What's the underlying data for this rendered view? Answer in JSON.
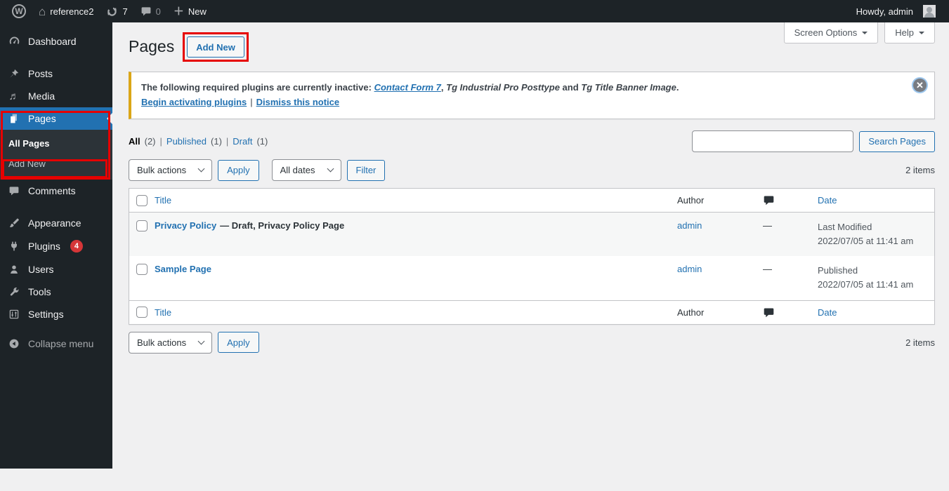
{
  "admin_bar": {
    "site_name": "reference2",
    "update_count": "7",
    "comment_count": "0",
    "new_label": "New",
    "howdy": "Howdy, admin"
  },
  "icons": {
    "wordpress_logo": "W",
    "home": "⌂",
    "plus": "＋",
    "media_note": "♬",
    "dismiss": "✕"
  },
  "sidebar": {
    "items": [
      {
        "label": "Dashboard"
      },
      {
        "label": "Posts"
      },
      {
        "label": "Media"
      },
      {
        "label": "Pages"
      },
      {
        "label": "Comments"
      },
      {
        "label": "Appearance"
      },
      {
        "label": "Plugins",
        "badge": "4"
      },
      {
        "label": "Users"
      },
      {
        "label": "Tools"
      },
      {
        "label": "Settings"
      }
    ],
    "submenu": {
      "all_pages": "All Pages",
      "add_new": "Add New"
    },
    "collapse": "Collapse menu"
  },
  "header": {
    "title": "Pages",
    "add_new_button": "Add New",
    "screen_options": "Screen Options",
    "help": "Help"
  },
  "notice": {
    "intro": "The following required plugins are currently inactive: ",
    "plugin_link": "Contact Form 7",
    "comma": ", ",
    "plugin2": "Tg Industrial Pro Posttype",
    "and": " and ",
    "plugin3": "Tg Title Banner Image",
    "period": ".",
    "activate_link": "Begin activating plugins",
    "separator": "|",
    "dismiss_link": "Dismiss this notice"
  },
  "views": {
    "all": "All",
    "all_count": "(2)",
    "published": "Published",
    "published_count": "(1)",
    "draft": "Draft",
    "draft_count": "(1)"
  },
  "toolbar": {
    "bulk_actions": "Bulk actions",
    "apply": "Apply",
    "all_dates": "All dates",
    "filter": "Filter",
    "search_button": "Search Pages",
    "items_count": "2 items"
  },
  "table": {
    "header": {
      "title": "Title",
      "author": "Author",
      "date": "Date"
    },
    "rows": [
      {
        "title": "Privacy Policy",
        "state": "— Draft, Privacy Policy Page",
        "author": "admin",
        "comments": "—",
        "date_status": "Last Modified",
        "date_value": "2022/07/05 at 11:41 am"
      },
      {
        "title": "Sample Page",
        "state": "",
        "author": "admin",
        "comments": "—",
        "date_status": "Published",
        "date_value": "2022/07/05 at 11:41 am"
      }
    ]
  },
  "colors": {
    "accent_blue": "#2271b1",
    "admin_dark": "#1d2327",
    "warning_border": "#dba617",
    "badge_red": "#d63638",
    "annotation_red": "#e60000"
  }
}
